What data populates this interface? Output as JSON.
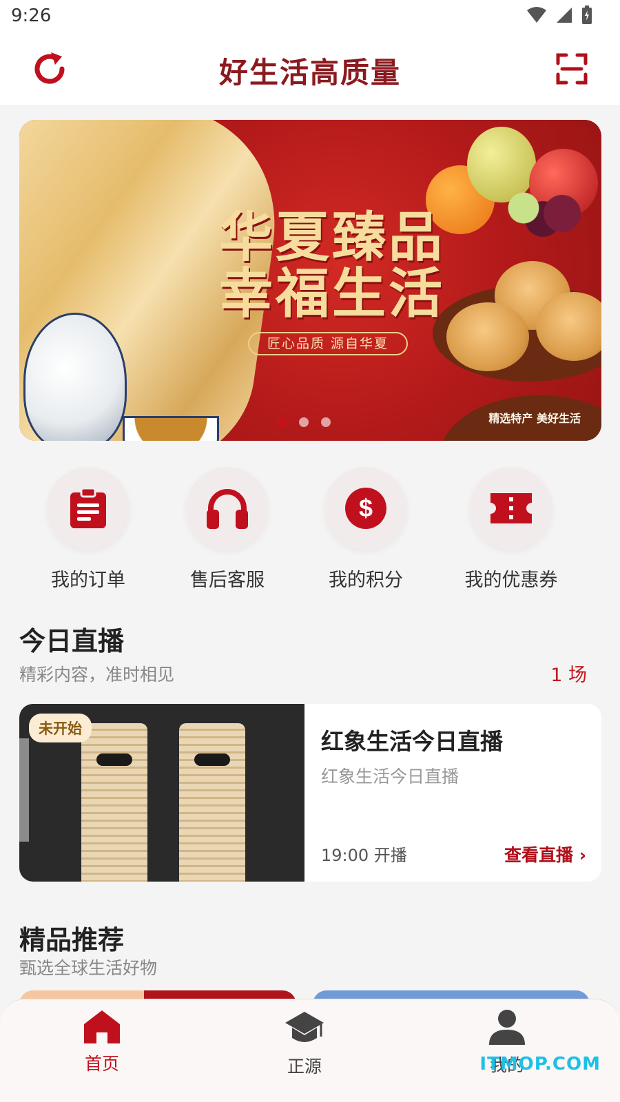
{
  "status_bar": {
    "time": "9:26"
  },
  "header": {
    "title": "好生活高质量",
    "refresh_icon": "refresh-icon",
    "scan_icon": "scan-icon"
  },
  "banner": {
    "headline_line1": "华夏臻品",
    "headline_line2": "幸福生活",
    "subtitle": "匠心品质 源自华夏",
    "tagline": "精选特产 美好生活",
    "active_slide": 1,
    "slide_count": 3
  },
  "quick_actions": [
    {
      "label": "我的订单",
      "icon": "clipboard-icon"
    },
    {
      "label": "售后客服",
      "icon": "headphones-icon"
    },
    {
      "label": "我的积分",
      "icon": "dollar-coin-icon"
    },
    {
      "label": "我的优惠券",
      "icon": "ticket-icon"
    }
  ],
  "live_section": {
    "title": "今日直播",
    "subtitle": "精彩内容，准时相见",
    "count": "1 场",
    "card": {
      "badge": "未开始",
      "title": "红象生活今日直播",
      "subtitle": "红象生活今日直播",
      "time": "19:00 开播",
      "action": "查看直播 ›"
    }
  },
  "recommend_section": {
    "title": "精品推荐",
    "subtitle": "甄选全球生活好物"
  },
  "tab_bar": {
    "tabs": [
      {
        "label": "首页",
        "icon": "home-icon",
        "active": true
      },
      {
        "label": "正源",
        "icon": "graduation-cap-icon",
        "active": false
      },
      {
        "label": "我的",
        "icon": "person-icon",
        "active": false
      }
    ]
  },
  "watermark": "ITMOP.COM",
  "colors": {
    "brand": "#8b1a1f",
    "accent": "#c8121a",
    "icon_red": "#c0101e"
  }
}
